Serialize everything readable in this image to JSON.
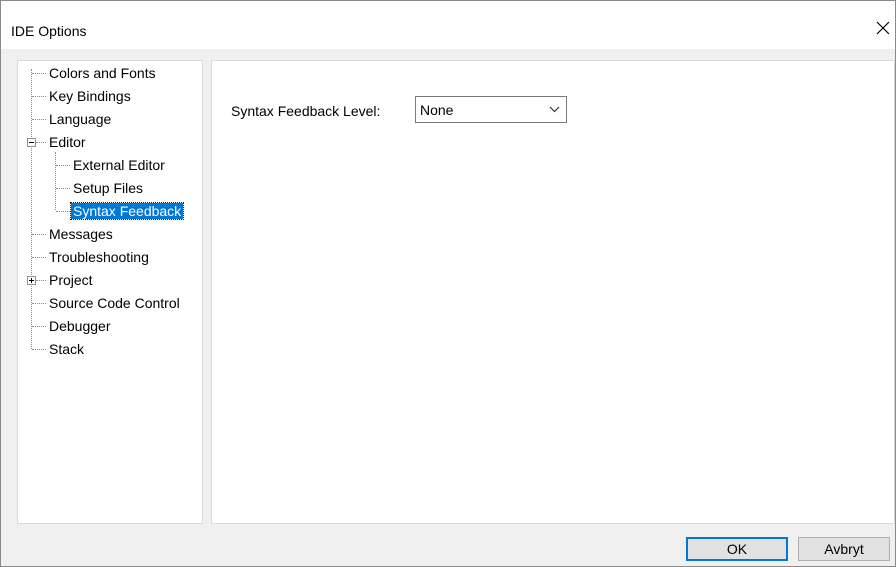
{
  "window": {
    "title": "IDE Options",
    "close_symbol": "✕"
  },
  "tree": {
    "items": [
      {
        "label": "Colors and Fonts"
      },
      {
        "label": "Key Bindings"
      },
      {
        "label": "Language"
      },
      {
        "label": "Editor",
        "expander": "−"
      },
      {
        "label": "External Editor"
      },
      {
        "label": "Setup Files"
      },
      {
        "label": "Syntax Feedback",
        "selected": true
      },
      {
        "label": "Messages"
      },
      {
        "label": "Troubleshooting"
      },
      {
        "label": "Project",
        "expander": "+"
      },
      {
        "label": "Source Code Control"
      },
      {
        "label": "Debugger"
      },
      {
        "label": "Stack"
      }
    ]
  },
  "panel": {
    "syntax_feedback_label": "Syntax Feedback Level:",
    "syntax_feedback_value": "None"
  },
  "buttons": {
    "ok": "OK",
    "cancel": "Avbryt"
  },
  "colors": {
    "selection": "#0078d7",
    "panel_bg": "#ffffff",
    "dialog_bg": "#f0f0f0"
  }
}
